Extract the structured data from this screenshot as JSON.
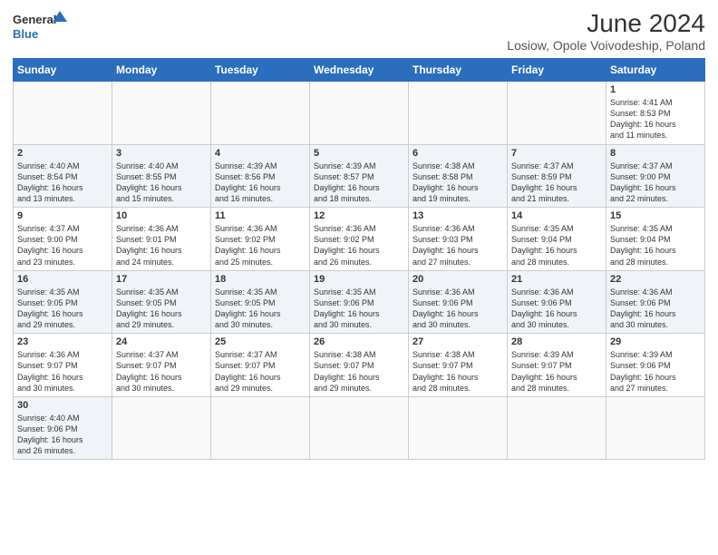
{
  "header": {
    "logo_general": "General",
    "logo_blue": "Blue",
    "month": "June 2024",
    "location": "Losiow, Opole Voivodeship, Poland"
  },
  "weekdays": [
    "Sunday",
    "Monday",
    "Tuesday",
    "Wednesday",
    "Thursday",
    "Friday",
    "Saturday"
  ],
  "weeks": [
    [
      {
        "day": "",
        "info": ""
      },
      {
        "day": "",
        "info": ""
      },
      {
        "day": "",
        "info": ""
      },
      {
        "day": "",
        "info": ""
      },
      {
        "day": "",
        "info": ""
      },
      {
        "day": "",
        "info": ""
      },
      {
        "day": "1",
        "info": "Sunrise: 4:41 AM\nSunset: 8:53 PM\nDaylight: 16 hours\nand 11 minutes."
      }
    ],
    [
      {
        "day": "2",
        "info": "Sunrise: 4:40 AM\nSunset: 8:54 PM\nDaylight: 16 hours\nand 13 minutes."
      },
      {
        "day": "3",
        "info": "Sunrise: 4:40 AM\nSunset: 8:55 PM\nDaylight: 16 hours\nand 15 minutes."
      },
      {
        "day": "4",
        "info": "Sunrise: 4:39 AM\nSunset: 8:56 PM\nDaylight: 16 hours\nand 16 minutes."
      },
      {
        "day": "5",
        "info": "Sunrise: 4:39 AM\nSunset: 8:57 PM\nDaylight: 16 hours\nand 18 minutes."
      },
      {
        "day": "6",
        "info": "Sunrise: 4:38 AM\nSunset: 8:58 PM\nDaylight: 16 hours\nand 19 minutes."
      },
      {
        "day": "7",
        "info": "Sunrise: 4:37 AM\nSunset: 8:59 PM\nDaylight: 16 hours\nand 21 minutes."
      },
      {
        "day": "8",
        "info": "Sunrise: 4:37 AM\nSunset: 9:00 PM\nDaylight: 16 hours\nand 22 minutes."
      }
    ],
    [
      {
        "day": "9",
        "info": "Sunrise: 4:37 AM\nSunset: 9:00 PM\nDaylight: 16 hours\nand 23 minutes."
      },
      {
        "day": "10",
        "info": "Sunrise: 4:36 AM\nSunset: 9:01 PM\nDaylight: 16 hours\nand 24 minutes."
      },
      {
        "day": "11",
        "info": "Sunrise: 4:36 AM\nSunset: 9:02 PM\nDaylight: 16 hours\nand 25 minutes."
      },
      {
        "day": "12",
        "info": "Sunrise: 4:36 AM\nSunset: 9:02 PM\nDaylight: 16 hours\nand 26 minutes."
      },
      {
        "day": "13",
        "info": "Sunrise: 4:36 AM\nSunset: 9:03 PM\nDaylight: 16 hours\nand 27 minutes."
      },
      {
        "day": "14",
        "info": "Sunrise: 4:35 AM\nSunset: 9:04 PM\nDaylight: 16 hours\nand 28 minutes."
      },
      {
        "day": "15",
        "info": "Sunrise: 4:35 AM\nSunset: 9:04 PM\nDaylight: 16 hours\nand 28 minutes."
      }
    ],
    [
      {
        "day": "16",
        "info": "Sunrise: 4:35 AM\nSunset: 9:05 PM\nDaylight: 16 hours\nand 29 minutes."
      },
      {
        "day": "17",
        "info": "Sunrise: 4:35 AM\nSunset: 9:05 PM\nDaylight: 16 hours\nand 29 minutes."
      },
      {
        "day": "18",
        "info": "Sunrise: 4:35 AM\nSunset: 9:05 PM\nDaylight: 16 hours\nand 30 minutes."
      },
      {
        "day": "19",
        "info": "Sunrise: 4:35 AM\nSunset: 9:06 PM\nDaylight: 16 hours\nand 30 minutes."
      },
      {
        "day": "20",
        "info": "Sunrise: 4:36 AM\nSunset: 9:06 PM\nDaylight: 16 hours\nand 30 minutes."
      },
      {
        "day": "21",
        "info": "Sunrise: 4:36 AM\nSunset: 9:06 PM\nDaylight: 16 hours\nand 30 minutes."
      },
      {
        "day": "22",
        "info": "Sunrise: 4:36 AM\nSunset: 9:06 PM\nDaylight: 16 hours\nand 30 minutes."
      }
    ],
    [
      {
        "day": "23",
        "info": "Sunrise: 4:36 AM\nSunset: 9:07 PM\nDaylight: 16 hours\nand 30 minutes."
      },
      {
        "day": "24",
        "info": "Sunrise: 4:37 AM\nSunset: 9:07 PM\nDaylight: 16 hours\nand 30 minutes."
      },
      {
        "day": "25",
        "info": "Sunrise: 4:37 AM\nSunset: 9:07 PM\nDaylight: 16 hours\nand 29 minutes."
      },
      {
        "day": "26",
        "info": "Sunrise: 4:38 AM\nSunset: 9:07 PM\nDaylight: 16 hours\nand 29 minutes."
      },
      {
        "day": "27",
        "info": "Sunrise: 4:38 AM\nSunset: 9:07 PM\nDaylight: 16 hours\nand 28 minutes."
      },
      {
        "day": "28",
        "info": "Sunrise: 4:39 AM\nSunset: 9:07 PM\nDaylight: 16 hours\nand 28 minutes."
      },
      {
        "day": "29",
        "info": "Sunrise: 4:39 AM\nSunset: 9:06 PM\nDaylight: 16 hours\nand 27 minutes."
      }
    ],
    [
      {
        "day": "30",
        "info": "Sunrise: 4:40 AM\nSunset: 9:06 PM\nDaylight: 16 hours\nand 26 minutes."
      },
      {
        "day": "",
        "info": ""
      },
      {
        "day": "",
        "info": ""
      },
      {
        "day": "",
        "info": ""
      },
      {
        "day": "",
        "info": ""
      },
      {
        "day": "",
        "info": ""
      },
      {
        "day": "",
        "info": ""
      }
    ]
  ]
}
